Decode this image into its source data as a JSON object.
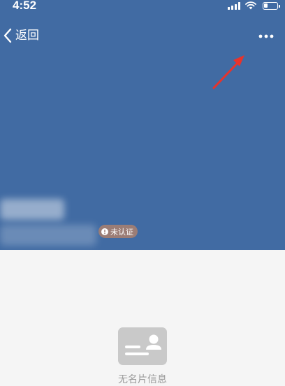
{
  "status_bar": {
    "time": "4:52",
    "icons": [
      "signal-icon",
      "wifi-icon",
      "battery-icon"
    ]
  },
  "nav": {
    "back_label": "返回",
    "back_icon": "chevron-left-icon",
    "more_icon": "more-icon"
  },
  "profile": {
    "badge_label": "未认证",
    "badge_icon": "alert-circle-icon"
  },
  "empty_state": {
    "icon": "business-card-icon",
    "label": "无名片信息"
  },
  "colors": {
    "hero_bg": "#416ba3",
    "page_bg": "#f5f5f5",
    "badge_bg": "#9b7d76",
    "annotation_arrow": "#e8332b"
  }
}
